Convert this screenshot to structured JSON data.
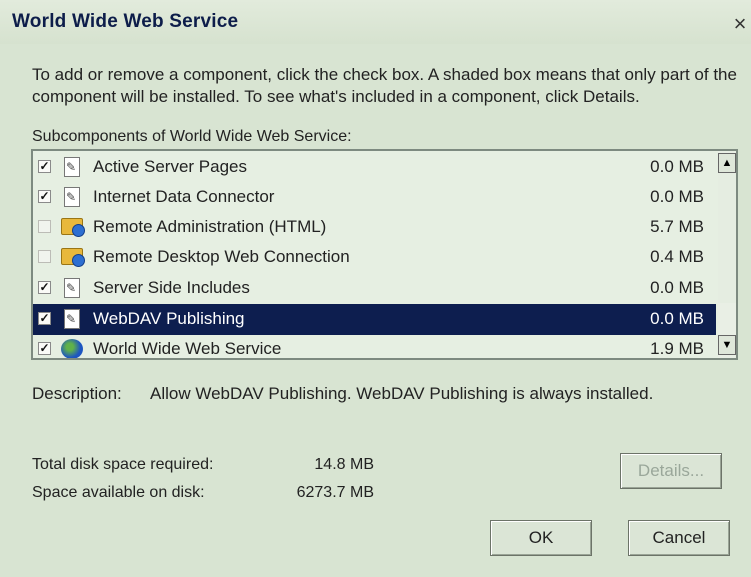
{
  "window": {
    "title": "World Wide Web Service",
    "close_glyph": "×"
  },
  "intro_text": "To add or remove a component, click the check box. A shaded box means that only part of the component will be installed. To see what's included in a component, click Details.",
  "subcomponents_label": "Subcomponents of World Wide Web Service:",
  "components": [
    {
      "name": "Active Server Pages",
      "size": "0.0 MB",
      "checked": true,
      "icon": "document-icon"
    },
    {
      "name": "Internet Data Connector",
      "size": "0.0 MB",
      "checked": true,
      "icon": "document-icon"
    },
    {
      "name": "Remote Administration (HTML)",
      "size": "5.7 MB",
      "checked": false,
      "icon": "folder-icon"
    },
    {
      "name": "Remote Desktop Web Connection",
      "size": "0.4 MB",
      "checked": false,
      "icon": "folder-icon"
    },
    {
      "name": "Server Side Includes",
      "size": "0.0 MB",
      "checked": true,
      "icon": "document-icon"
    },
    {
      "name": "WebDAV Publishing",
      "size": "0.0 MB",
      "checked": true,
      "icon": "document-icon",
      "selected": true
    },
    {
      "name": "World Wide Web Service",
      "size": "1.9 MB",
      "checked": true,
      "icon": "globe-icon"
    }
  ],
  "description": {
    "label": "Description:",
    "text": "Allow WebDAV Publishing.  WebDAV Publishing is always installed."
  },
  "disk": {
    "required_label": "Total disk space required:",
    "required_value": "14.8 MB",
    "available_label": "Space available on disk:",
    "available_value": "6273.7 MB"
  },
  "buttons": {
    "details": "Details...",
    "ok": "OK",
    "cancel": "Cancel"
  },
  "colors": {
    "selection": "#0d1e4f",
    "background": "#d8e4d2"
  }
}
